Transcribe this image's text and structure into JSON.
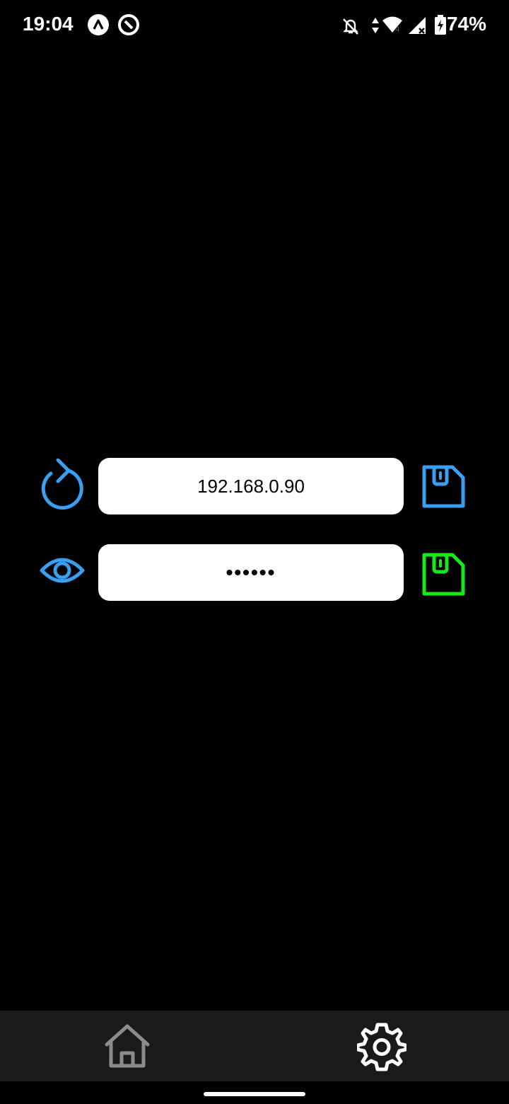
{
  "status_bar": {
    "time": "19:04",
    "battery": "74%",
    "icons": [
      "app-a-icon",
      "app-circle-icon",
      "notifications-off-icon",
      "data-arrows-icon",
      "wifi-icon",
      "signal-icon",
      "battery-charging-icon"
    ]
  },
  "connection": {
    "ip_address": "192.168.0.90",
    "password_masked": "••••••"
  },
  "colors": {
    "accent_blue": "#3a9ff0",
    "accent_green": "#17e81b",
    "nav_bg": "#1a1a1a"
  },
  "bottom_nav": {
    "items": [
      "home-icon",
      "settings-icon"
    ]
  }
}
